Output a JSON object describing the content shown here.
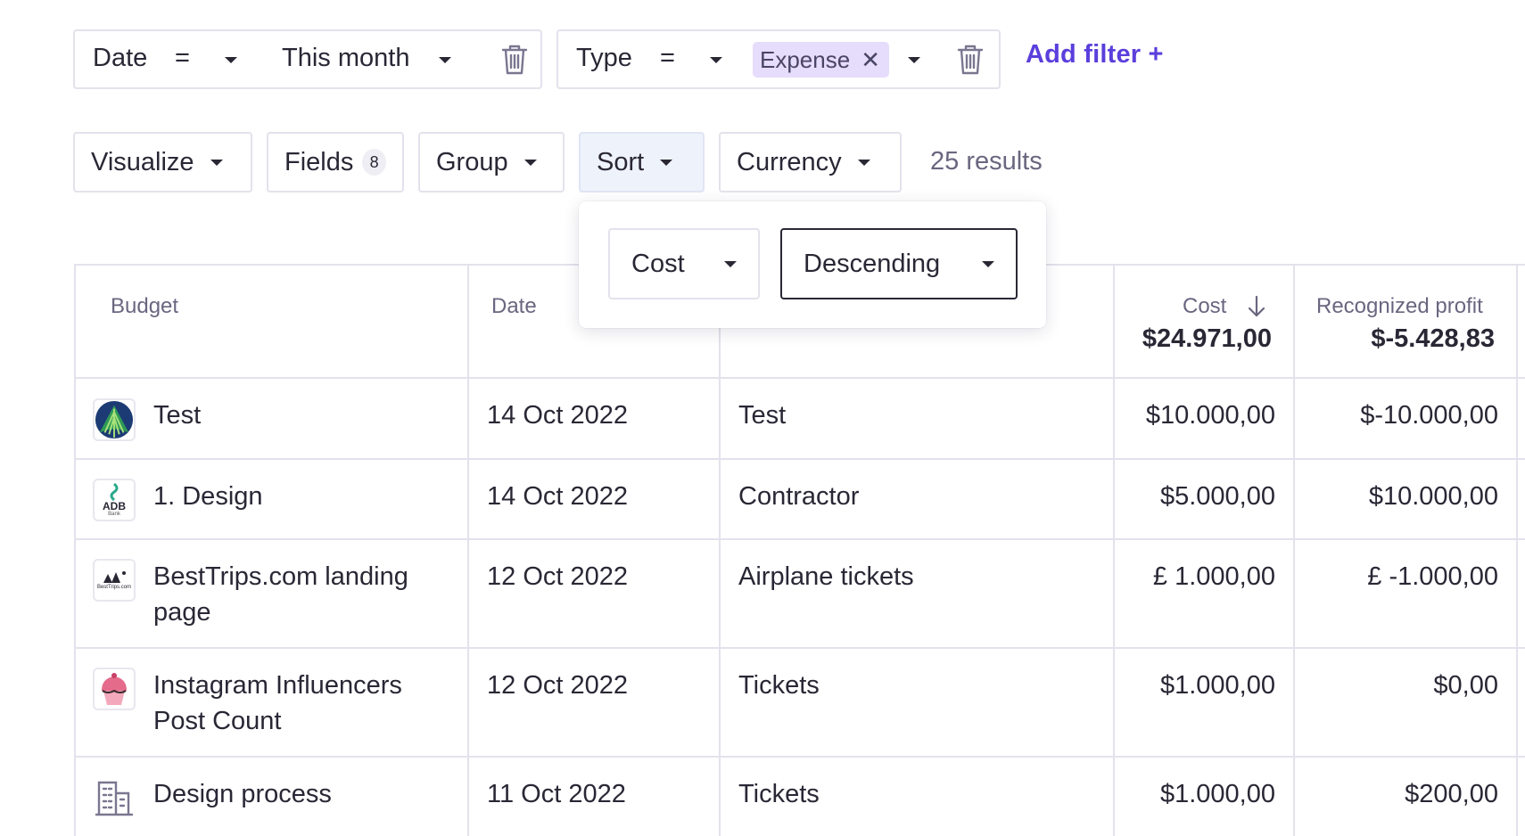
{
  "filters": [
    {
      "field": "Date",
      "operator": "=",
      "value": "This month"
    },
    {
      "field": "Type",
      "operator": "=",
      "chip": "Expense"
    }
  ],
  "add_filter_label": "Add filter +",
  "toolbar": {
    "visualize": "Visualize",
    "fields": "Fields",
    "fields_count": "8",
    "group": "Group",
    "sort": "Sort",
    "currency": "Currency",
    "results": "25 results"
  },
  "sort_popover": {
    "field": "Cost",
    "direction": "Descending"
  },
  "table": {
    "headers": {
      "budget": "Budget",
      "date": "Date",
      "cost": "Cost",
      "profit": "Recognized profit"
    },
    "totals": {
      "cost": "$24.971,00",
      "profit": "$-5.428,83"
    },
    "rows": [
      {
        "budget": "Test",
        "date": "14 Oct 2022",
        "type": "Test",
        "cost": "$10.000,00",
        "profit": "$-10.000,00",
        "logo": "globe-logo"
      },
      {
        "budget": "1. Design",
        "date": "14 Oct 2022",
        "type": "Contractor",
        "cost": "$5.000,00",
        "profit": "$10.000,00",
        "logo": "adb-bank-logo",
        "logo_text": "ADB",
        "logo_sub": "Bank"
      },
      {
        "budget": "BestTrips.com landing",
        "budget2": "page",
        "date": "12 Oct 2022",
        "type": "Airplane tickets",
        "cost": "£ 1.000,00",
        "profit": "£ -1.000,00",
        "logo": "besttrips-logo",
        "logo_text": "BestTrips.com"
      },
      {
        "budget": "Instagram Influencers",
        "budget2": "Post Count",
        "date": "12 Oct 2022",
        "type": "Tickets",
        "cost": "$1.000,00",
        "profit": "$0,00",
        "logo": "cupcake-logo"
      },
      {
        "budget": "Design process",
        "date": "11 Oct 2022",
        "type": "Tickets",
        "cost": "$1.000,00",
        "profit": "$200,00",
        "logo": "building-icon"
      }
    ]
  },
  "colors": {
    "accent": "#5b3fdc",
    "chip_bg": "#e6dcfb",
    "border": "#e3e2ec",
    "sort_active_bg": "#eef2fb"
  }
}
